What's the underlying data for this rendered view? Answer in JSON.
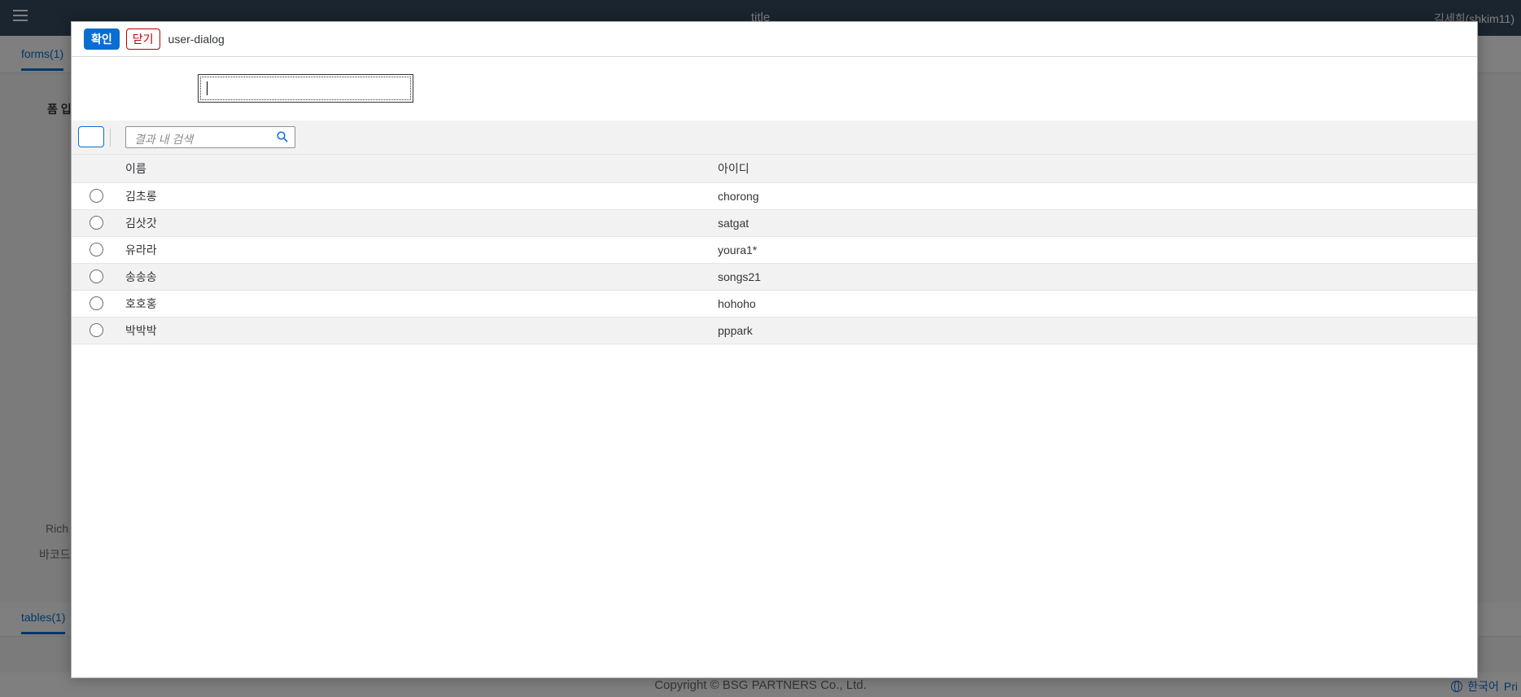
{
  "app": {
    "title": "title",
    "user": "김세희(shkim11)",
    "tabs": {
      "forms": "forms(1)",
      "tables": "tables(1)"
    },
    "labels": {
      "form_input": "폼 입",
      "rich": "Rich",
      "barcode": "바코드"
    },
    "footer": {
      "copyright": "Copyright © BSG PARTNERS Co., Ltd.",
      "language": "한국어",
      "privacy": "Pri"
    }
  },
  "dialog": {
    "confirm_label": "확인",
    "close_label": "닫기",
    "title": "user-dialog",
    "search_placeholder": "결과 내 검색",
    "columns": {
      "name": "이름",
      "id": "아이디"
    },
    "rows": [
      {
        "name": "김초롱",
        "id": "chorong"
      },
      {
        "name": "김삿갓",
        "id": "satgat"
      },
      {
        "name": "유라라",
        "id": "youra1*"
      },
      {
        "name": "송송송",
        "id": "songs21"
      },
      {
        "name": "호호홍",
        "id": "hohoho"
      },
      {
        "name": "박박박",
        "id": "pppark"
      }
    ]
  },
  "colors": {
    "accent": "#0a6ed1",
    "shell": "#354a5f",
    "negative": "#bb0000"
  }
}
